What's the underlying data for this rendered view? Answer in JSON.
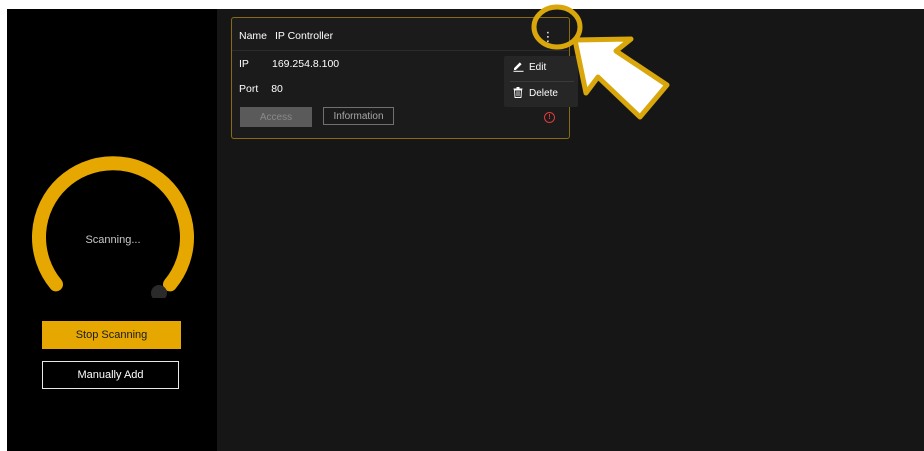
{
  "colors": {
    "accent": "#e6a800",
    "highlight": "#d9a70c",
    "warning": "#e03a3a",
    "sidebar_bg": "#000000",
    "main_bg": "#161616"
  },
  "sidebar": {
    "scan_progress_ring": {
      "status_text": "Scanning..."
    },
    "stop_button": "Stop Scanning",
    "manual_add_button": "Manually Add"
  },
  "device_card": {
    "name_label": "Name",
    "name_value": "IP Controller",
    "ip_label": "IP",
    "ip_value": "169.254.8.100",
    "port_label": "Port",
    "port_value": "80",
    "access_button": "Access",
    "information_button": "Information",
    "more_icon": "more-vertical-icon",
    "warning_icon": "alert-circle-icon"
  },
  "context_menu": {
    "items": [
      {
        "label": "Edit",
        "icon": "pencil-icon"
      },
      {
        "label": "Delete",
        "icon": "trash-icon"
      }
    ]
  },
  "annotation": {
    "circle_target": "more-options",
    "arrow_icon": "pointer-arrow-icon"
  }
}
